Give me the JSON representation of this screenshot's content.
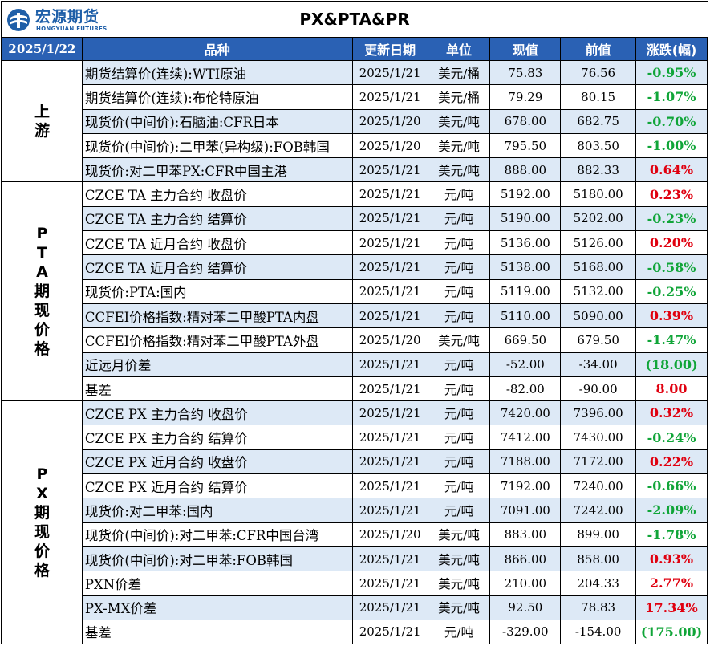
{
  "header": {
    "logo_cn": "宏源期货",
    "logo_en": "HONGYUAN FUTURES",
    "title": "PX&PTA&PR"
  },
  "columns": {
    "date": "2025/1/22",
    "item": "品种",
    "update": "更新日期",
    "unit": "单位",
    "current": "现值",
    "previous": "前值",
    "change": "涨跌(幅)"
  },
  "groups": [
    {
      "label": "上游",
      "rows": [
        {
          "name": "期货结算价(连续):WTI原油",
          "date": "2025/1/21",
          "unit": "美元/桶",
          "current": "75.83",
          "previous": "76.56",
          "change": "-0.95%",
          "dir": "down"
        },
        {
          "name": "期货结算价(连续):布伦特原油",
          "date": "2025/1/21",
          "unit": "美元/桶",
          "current": "79.29",
          "previous": "80.15",
          "change": "-1.07%",
          "dir": "down"
        },
        {
          "name": "现货价(中间价):石脑油:CFR日本",
          "date": "2025/1/20",
          "unit": "美元/吨",
          "current": "678.00",
          "previous": "682.75",
          "change": "-0.70%",
          "dir": "down"
        },
        {
          "name": "现货价(中间价):二甲苯(异构级):FOB韩国",
          "date": "2025/1/20",
          "unit": "美元/吨",
          "current": "795.50",
          "previous": "803.50",
          "change": "-1.00%",
          "dir": "down"
        },
        {
          "name": "现货价:对二甲苯PX:CFR中国主港",
          "date": "2025/1/21",
          "unit": "美元/吨",
          "current": "888.00",
          "previous": "882.33",
          "change": "0.64%",
          "dir": "up"
        }
      ]
    },
    {
      "label": "PTA期现价格",
      "rows": [
        {
          "name": "CZCE TA 主力合约 收盘价",
          "date": "2025/1/21",
          "unit": "元/吨",
          "current": "5192.00",
          "previous": "5180.00",
          "change": "0.23%",
          "dir": "up"
        },
        {
          "name": "CZCE TA 主力合约 结算价",
          "date": "2025/1/21",
          "unit": "元/吨",
          "current": "5190.00",
          "previous": "5202.00",
          "change": "-0.23%",
          "dir": "down"
        },
        {
          "name": "CZCE TA 近月合约 收盘价",
          "date": "2025/1/21",
          "unit": "元/吨",
          "current": "5136.00",
          "previous": "5126.00",
          "change": "0.20%",
          "dir": "up"
        },
        {
          "name": "CZCE TA 近月合约 结算价",
          "date": "2025/1/21",
          "unit": "元/吨",
          "current": "5138.00",
          "previous": "5168.00",
          "change": "-0.58%",
          "dir": "down"
        },
        {
          "name": "现货价:PTA:国内",
          "date": "2025/1/21",
          "unit": "元/吨",
          "current": "5119.00",
          "previous": "5132.00",
          "change": "-0.25%",
          "dir": "down"
        },
        {
          "name": "CCFEI价格指数:精对苯二甲酸PTA内盘",
          "date": "2025/1/21",
          "unit": "元/吨",
          "current": "5110.00",
          "previous": "5090.00",
          "change": "0.39%",
          "dir": "up"
        },
        {
          "name": "CCFEI价格指数:精对苯二甲酸PTA外盘",
          "date": "2025/1/20",
          "unit": "美元/吨",
          "current": "669.50",
          "previous": "679.50",
          "change": "-1.47%",
          "dir": "down"
        },
        {
          "name": "近远月价差",
          "date": "2025/1/21",
          "unit": "元/吨",
          "current": "-52.00",
          "previous": "-34.00",
          "change": "(18.00)",
          "dir": "down"
        },
        {
          "name": "基差",
          "date": "2025/1/21",
          "unit": "元/吨",
          "current": "-82.00",
          "previous": "-90.00",
          "change": "8.00",
          "dir": "up"
        }
      ]
    },
    {
      "label": "PX期现价格",
      "rows": [
        {
          "name": "CZCE PX 主力合约 收盘价",
          "date": "2025/1/21",
          "unit": "元/吨",
          "current": "7420.00",
          "previous": "7396.00",
          "change": "0.32%",
          "dir": "up"
        },
        {
          "name": "CZCE PX 主力合约 结算价",
          "date": "2025/1/21",
          "unit": "元/吨",
          "current": "7412.00",
          "previous": "7430.00",
          "change": "-0.24%",
          "dir": "down"
        },
        {
          "name": "CZCE PX 近月合约 收盘价",
          "date": "2025/1/21",
          "unit": "元/吨",
          "current": "7188.00",
          "previous": "7172.00",
          "change": "0.22%",
          "dir": "up"
        },
        {
          "name": "CZCE PX 近月合约 结算价",
          "date": "2025/1/21",
          "unit": "元/吨",
          "current": "7192.00",
          "previous": "7240.00",
          "change": "-0.66%",
          "dir": "down"
        },
        {
          "name": "现货价:对二甲苯:国内",
          "date": "2025/1/21",
          "unit": "元/吨",
          "current": "7091.00",
          "previous": "7242.00",
          "change": "-2.09%",
          "dir": "down"
        },
        {
          "name": "现货价(中间价):对二甲苯:CFR中国台湾",
          "date": "2025/1/20",
          "unit": "美元/吨",
          "current": "883.00",
          "previous": "899.00",
          "change": "-1.78%",
          "dir": "down"
        },
        {
          "name": "现货价(中间价):对二甲苯:FOB韩国",
          "date": "2025/1/21",
          "unit": "美元/吨",
          "current": "866.00",
          "previous": "858.00",
          "change": "0.93%",
          "dir": "up"
        },
        {
          "name": "PXN价差",
          "date": "2025/1/21",
          "unit": "美元/吨",
          "current": "210.00",
          "previous": "204.33",
          "change": "2.77%",
          "dir": "up"
        },
        {
          "name": "PX-MX价差",
          "date": "2025/1/21",
          "unit": "美元/吨",
          "current": "92.50",
          "previous": "78.83",
          "change": "17.34%",
          "dir": "up"
        },
        {
          "name": "基差",
          "date": "2025/1/21",
          "unit": "元/吨",
          "current": "-329.00",
          "previous": "-154.00",
          "change": "(175.00)",
          "dir": "down"
        }
      ]
    }
  ]
}
